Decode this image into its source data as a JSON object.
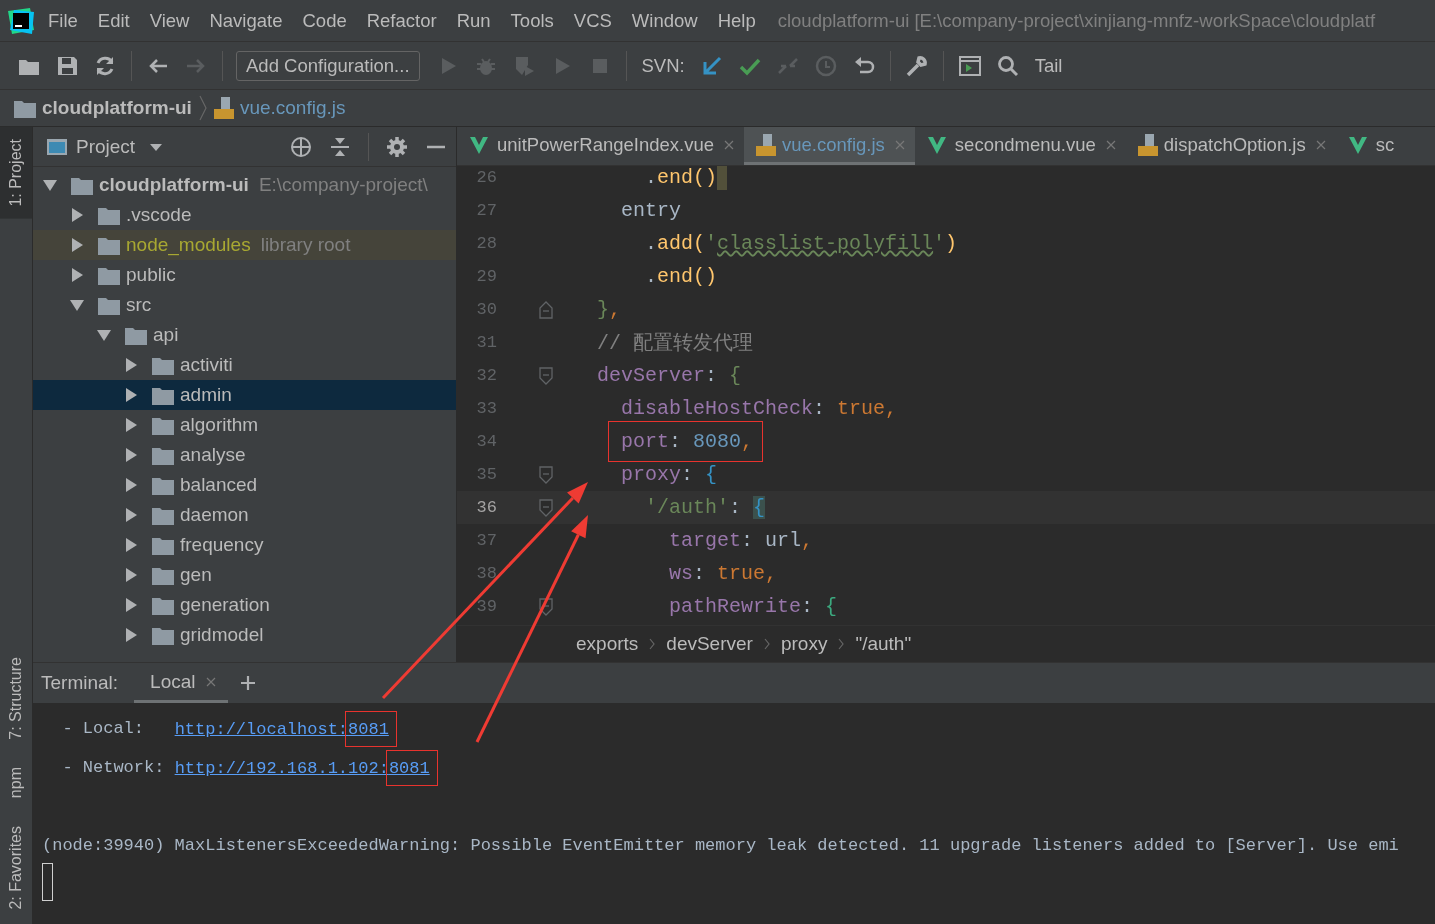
{
  "menu_bar": {
    "items": [
      "File",
      "Edit",
      "View",
      "Navigate",
      "Code",
      "Refactor",
      "Run",
      "Tools",
      "VCS",
      "Window",
      "Help"
    ],
    "window_title": "cloudplatform-ui [E:\\company-project\\xinjiang-mnfz-workSpace\\cloudplatf"
  },
  "toolbar": [
    {
      "kind": "open",
      "disabled": false
    },
    {
      "kind": "save",
      "disabled": false
    },
    {
      "kind": "sync",
      "disabled": false
    },
    {
      "kind": "separator"
    },
    {
      "kind": "back",
      "disabled": false
    },
    {
      "kind": "forward",
      "disabled": true
    },
    {
      "kind": "separator"
    },
    {
      "kind": "button",
      "label": "Add Configuration..."
    },
    {
      "kind": "run",
      "disabled": true
    },
    {
      "kind": "debug",
      "disabled": true
    },
    {
      "kind": "coverage",
      "disabled": true
    },
    {
      "kind": "run",
      "disabled": true
    },
    {
      "kind": "stop",
      "disabled": true
    },
    {
      "kind": "separator"
    },
    {
      "kind": "label",
      "label": "SVN:"
    },
    {
      "kind": "update",
      "disabled": false
    },
    {
      "kind": "commit",
      "disabled": false
    },
    {
      "kind": "compare",
      "disabled": true
    },
    {
      "kind": "history",
      "disabled": true
    },
    {
      "kind": "revert",
      "disabled": false
    },
    {
      "kind": "separator"
    },
    {
      "kind": "wrench",
      "disabled": false
    },
    {
      "kind": "separator"
    },
    {
      "kind": "terminal",
      "disabled": false
    },
    {
      "kind": "search",
      "disabled": false
    },
    {
      "kind": "label",
      "label": "Tail"
    }
  ],
  "breadcrumb": [
    {
      "label": "cloudplatform-ui",
      "kind": "folder"
    },
    {
      "label": "vue.config.js",
      "kind": "js"
    }
  ],
  "tool_strip": {
    "top": [
      {
        "label": "1: Project",
        "selected": true
      }
    ],
    "bottom": [
      {
        "label": "7: Structure",
        "selected": false
      },
      {
        "label": "npm",
        "selected": false
      },
      {
        "label": "2: Favorites",
        "selected": false
      }
    ]
  },
  "project_panel": {
    "title": "Project",
    "tree": [
      {
        "label": "cloudplatform-ui",
        "note": "E:\\company-project\\",
        "kind": "project",
        "expanded": true,
        "selected": false,
        "children": [
          {
            "label": ".vscode",
            "kind": "folder",
            "expanded": false,
            "selected": false
          },
          {
            "label": "node_modules",
            "note": "library root",
            "kind": "library",
            "expanded": false,
            "selected": false
          },
          {
            "label": "public",
            "kind": "folder",
            "expanded": false,
            "selected": false
          },
          {
            "label": "src",
            "kind": "folder",
            "expanded": true,
            "selected": false,
            "children": [
              {
                "label": "api",
                "kind": "folder",
                "expanded": true,
                "selected": false,
                "children": [
                  {
                    "label": "activiti",
                    "kind": "folder",
                    "expanded": false,
                    "selected": false
                  },
                  {
                    "label": "admin",
                    "kind": "folder",
                    "expanded": false,
                    "selected": true
                  },
                  {
                    "label": "algorithm",
                    "kind": "folder",
                    "expanded": false,
                    "selected": false
                  },
                  {
                    "label": "analyse",
                    "kind": "folder",
                    "expanded": false,
                    "selected": false
                  },
                  {
                    "label": "balanced",
                    "kind": "folder",
                    "expanded": false,
                    "selected": false
                  },
                  {
                    "label": "daemon",
                    "kind": "folder",
                    "expanded": false,
                    "selected": false
                  },
                  {
                    "label": "frequency",
                    "kind": "folder",
                    "expanded": false,
                    "selected": false
                  },
                  {
                    "label": "gen",
                    "kind": "folder",
                    "expanded": false,
                    "selected": false
                  },
                  {
                    "label": "generation",
                    "kind": "folder",
                    "expanded": false,
                    "selected": false
                  },
                  {
                    "label": "gridmodel",
                    "kind": "folder",
                    "expanded": false,
                    "selected": false
                  }
                ]
              }
            ]
          }
        ]
      }
    ]
  },
  "editor": {
    "tabs": [
      {
        "label": "unitPowerRangeIndex.vue",
        "kind": "vue",
        "selected": false,
        "closable": true
      },
      {
        "label": "vue.config.js",
        "kind": "js",
        "selected": true,
        "closable": true
      },
      {
        "label": "secondmenu.vue",
        "kind": "vue",
        "selected": false,
        "closable": true
      },
      {
        "label": "dispatchOption.js",
        "kind": "js",
        "selected": false,
        "closable": true
      },
      {
        "label": "sc",
        "kind": "vue",
        "selected": false,
        "closable": false
      }
    ],
    "lines": [
      {
        "number": "26",
        "kind": "plain",
        "current": false,
        "caret": true,
        "tokens": [
          {
            "text": "      .",
            "kind": "plain"
          },
          {
            "text": "end()",
            "kind": "call"
          }
        ]
      },
      {
        "number": "27",
        "kind": "plain",
        "current": false,
        "tokens": [
          {
            "text": "    entry",
            "kind": "plain"
          }
        ]
      },
      {
        "number": "28",
        "kind": "plain",
        "current": false,
        "tokens": [
          {
            "text": "      .",
            "kind": "plain"
          },
          {
            "text": "add(",
            "kind": "call"
          },
          {
            "text": "'",
            "kind": "string"
          },
          {
            "text": "classlist-polyfill",
            "kind": "string",
            "typo": true
          },
          {
            "text": "'",
            "kind": "string"
          },
          {
            "text": ")",
            "kind": "call"
          }
        ]
      },
      {
        "number": "29",
        "kind": "plain",
        "current": false,
        "tokens": [
          {
            "text": "      .",
            "kind": "plain"
          },
          {
            "text": "end()",
            "kind": "call"
          }
        ]
      },
      {
        "number": "30",
        "kind": "foldend",
        "current": false,
        "tokens": [
          {
            "text": "  }",
            "kind": "brace"
          },
          {
            "text": ",",
            "kind": "keyword"
          }
        ]
      },
      {
        "number": "31",
        "kind": "plain",
        "current": false,
        "tokens": [
          {
            "text": "  // 配置转发代理",
            "kind": "comment"
          }
        ]
      },
      {
        "number": "32",
        "kind": "foldstart",
        "current": false,
        "tokens": [
          {
            "text": "  devServer",
            "kind": "property"
          },
          {
            "text": ": ",
            "kind": "plain"
          },
          {
            "text": "{",
            "kind": "brace"
          }
        ]
      },
      {
        "number": "33",
        "kind": "plain",
        "current": false,
        "tokens": [
          {
            "text": "    disableHostCheck",
            "kind": "property"
          },
          {
            "text": ": ",
            "kind": "plain"
          },
          {
            "text": "true,",
            "kind": "keyword"
          }
        ]
      },
      {
        "number": "34",
        "kind": "plain",
        "current": false,
        "boxed": true,
        "tokens": [
          {
            "text": "port",
            "kind": "property"
          },
          {
            "text": ": ",
            "kind": "plain"
          },
          {
            "text": "8080",
            "kind": "number"
          },
          {
            "text": ",",
            "kind": "keyword"
          }
        ]
      },
      {
        "number": "35",
        "kind": "foldstart",
        "current": false,
        "tokens": [
          {
            "text": "    proxy",
            "kind": "property"
          },
          {
            "text": ": ",
            "kind": "plain"
          },
          {
            "text": "{",
            "kind": "bracealt"
          }
        ]
      },
      {
        "number": "36",
        "kind": "foldstart",
        "current": true,
        "tokens": [
          {
            "text": "      '/auth'",
            "kind": "string"
          },
          {
            "text": ": ",
            "kind": "plain"
          },
          {
            "text": "{",
            "kind": "bracealt",
            "matched": true
          }
        ]
      },
      {
        "number": "37",
        "kind": "plain",
        "current": false,
        "tokens": [
          {
            "text": "        target",
            "kind": "property"
          },
          {
            "text": ": url",
            "kind": "plain"
          },
          {
            "text": ",",
            "kind": "keyword"
          }
        ]
      },
      {
        "number": "38",
        "kind": "plain",
        "current": false,
        "tokens": [
          {
            "text": "        ws",
            "kind": "property"
          },
          {
            "text": ": ",
            "kind": "plain"
          },
          {
            "text": "true,",
            "kind": "keyword"
          }
        ]
      },
      {
        "number": "39",
        "kind": "foldstart",
        "current": false,
        "tokens": [
          {
            "text": "        pathRewrite",
            "kind": "property"
          },
          {
            "text": ": ",
            "kind": "plain"
          },
          {
            "text": "{",
            "kind": "bracegreen"
          }
        ]
      }
    ],
    "breadcrumb": [
      "exports",
      "devServer",
      "proxy",
      "\"/auth\""
    ]
  },
  "terminal": {
    "title": "Terminal:",
    "tabs": [
      {
        "label": "Local",
        "selected": true
      }
    ],
    "lines": [
      {
        "kind": "url",
        "label": "  - Local:   ",
        "link": "http://localhost:",
        "port": "8081"
      },
      {
        "kind": "url",
        "label": "  - Network: ",
        "link": "http://192.168.1.102:",
        "port": "8081"
      },
      {
        "kind": "warning",
        "text": "(node:39940) MaxListenersExceededWarning: Possible EventEmitter memory leak detected. 11 upgrade listeners added to [Server]. Use emi"
      }
    ]
  }
}
